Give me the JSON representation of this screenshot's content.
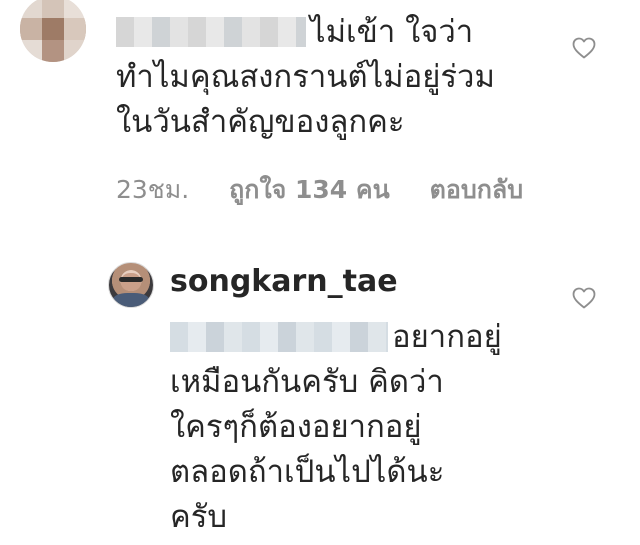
{
  "comments": [
    {
      "avatar": "blurred-avatar",
      "text_line1": "ไม่เข้า ใจว่า",
      "text_line2": "ทำไมคุณสงกรานต์ไม่อยู่ร่วม",
      "text_line3": "ในวันสำคัญของลูกคะ",
      "time": "23ชม.",
      "likes": "ถูกใจ 134 คน",
      "reply_label": "ตอบกลับ",
      "like_icon": "heart-outline-icon"
    },
    {
      "avatar": "profile-photo",
      "username": "songkarn_tae",
      "text_line1": "อยากอยู่",
      "text_line2": "เหมือนกันครับ คิดว่า",
      "text_line3": "ใครๆก็ต้องอยากอยู่",
      "text_line4": "ตลอดถ้าเป็นไปได้นะ",
      "text_line5": "ครับ",
      "like_icon": "heart-outline-icon"
    }
  ],
  "colors": {
    "text": "#262626",
    "secondary": "#8e8e8e",
    "background": "#ffffff"
  }
}
